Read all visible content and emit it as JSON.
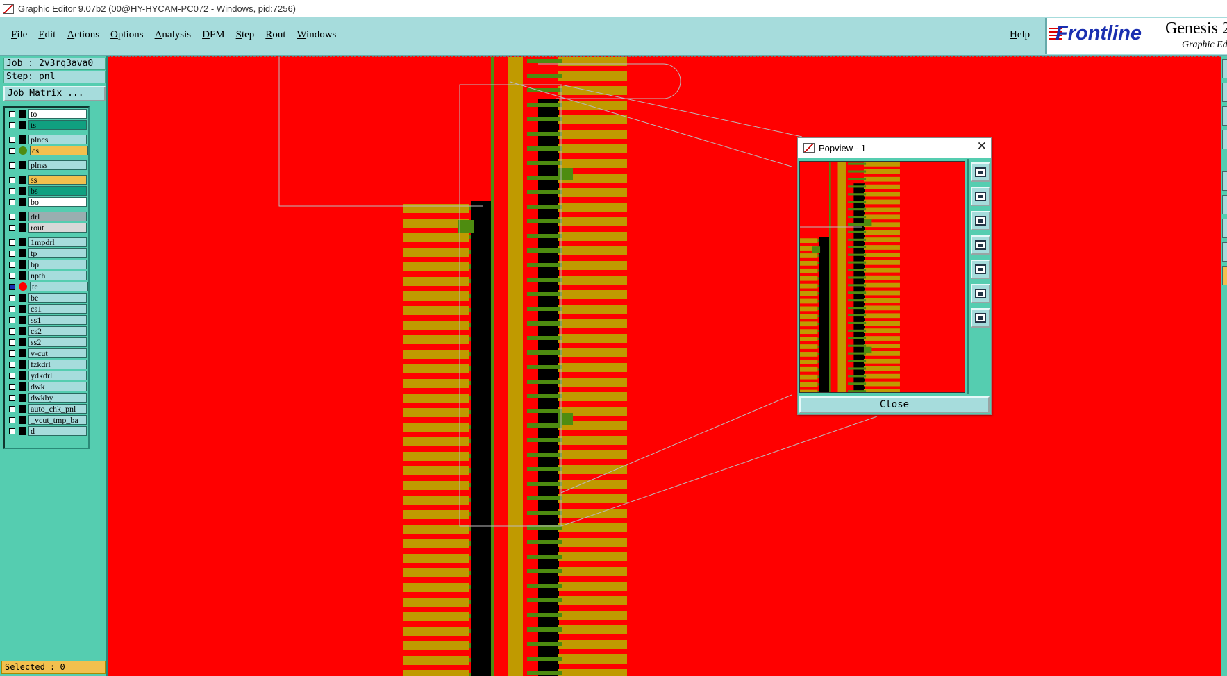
{
  "window": {
    "title": "Graphic Editor 9.07b2 (00@HY-HYCAM-PC072 - Windows, pid:7256)"
  },
  "menu": {
    "items": [
      "File",
      "Edit",
      "Actions",
      "Options",
      "Analysis",
      "DFM",
      "Step",
      "Rout",
      "Windows"
    ],
    "help": "Help"
  },
  "brand": {
    "logo": "Frontline",
    "product": "Genesis 2",
    "subtitle": "Graphic Editor"
  },
  "job": {
    "job_label": "Job : 2v3rq3ava0",
    "step_label": "Step: pnl",
    "matrix_button": "Job Matrix ..."
  },
  "colors": {
    "panel": "#55cdb0",
    "light": "#a6dcdc",
    "canvas": "#ff0000",
    "copper": "#c09a00",
    "green": "#4e8c10",
    "black": "#000000",
    "yellow": "#f2c04e",
    "teal": "#10a080",
    "grey": "#9aaeb0",
    "lightgrey": "#d8d8d8"
  },
  "layers": [
    {
      "name": "to",
      "color": "#ffffff"
    },
    {
      "name": "ts",
      "color": "#10a080"
    },
    {
      "name": "plncs",
      "color": "#a6dcdc"
    },
    {
      "name": "cs",
      "color": "#f2c04e",
      "dot": "#4e8c10"
    },
    {
      "name": "plnss",
      "color": "#a6dcdc"
    },
    {
      "name": "ss",
      "color": "#f2c04e"
    },
    {
      "name": "bs",
      "color": "#10a080"
    },
    {
      "name": "bo",
      "color": "#ffffff"
    },
    {
      "name": "drl",
      "color": "#9aaeb0"
    },
    {
      "name": "rout",
      "color": "#d8d8d8"
    },
    {
      "name": "1mpdrl",
      "color": "#a6dcdc"
    },
    {
      "name": "tp",
      "color": "#a6dcdc"
    },
    {
      "name": "bp",
      "color": "#a6dcdc"
    },
    {
      "name": "npth",
      "color": "#a6dcdc"
    },
    {
      "name": "te",
      "color": "#a6dcdc",
      "dot": "#ff0000",
      "active": true
    },
    {
      "name": "be",
      "color": "#a6dcdc"
    },
    {
      "name": "cs1",
      "color": "#a6dcdc"
    },
    {
      "name": "ss1",
      "color": "#a6dcdc"
    },
    {
      "name": "cs2",
      "color": "#a6dcdc"
    },
    {
      "name": "ss2",
      "color": "#a6dcdc"
    },
    {
      "name": "v-cut",
      "color": "#a6dcdc"
    },
    {
      "name": "fzkdrl",
      "color": "#a6dcdc"
    },
    {
      "name": "ydkdrl",
      "color": "#a6dcdc"
    },
    {
      "name": "dwk",
      "color": "#a6dcdc"
    },
    {
      "name": "dwkby",
      "color": "#a6dcdc"
    },
    {
      "name": "auto_chk_pnl",
      "color": "#a6dcdc"
    },
    {
      "name": "_vcut_tmp_ba",
      "color": "#a6dcdc"
    },
    {
      "name": "d",
      "color": "#a6dcdc"
    }
  ],
  "status": {
    "selected": "Selected : 0"
  },
  "popview": {
    "title": "Popview - 1",
    "close_label": "Close",
    "tools": [
      "zoom-fit-icon",
      "pan-up-icon",
      "pan-down-icon",
      "pan-left-icon",
      "pan-right-icon",
      "zoom-in-icon",
      "zoom-out-icon"
    ]
  }
}
